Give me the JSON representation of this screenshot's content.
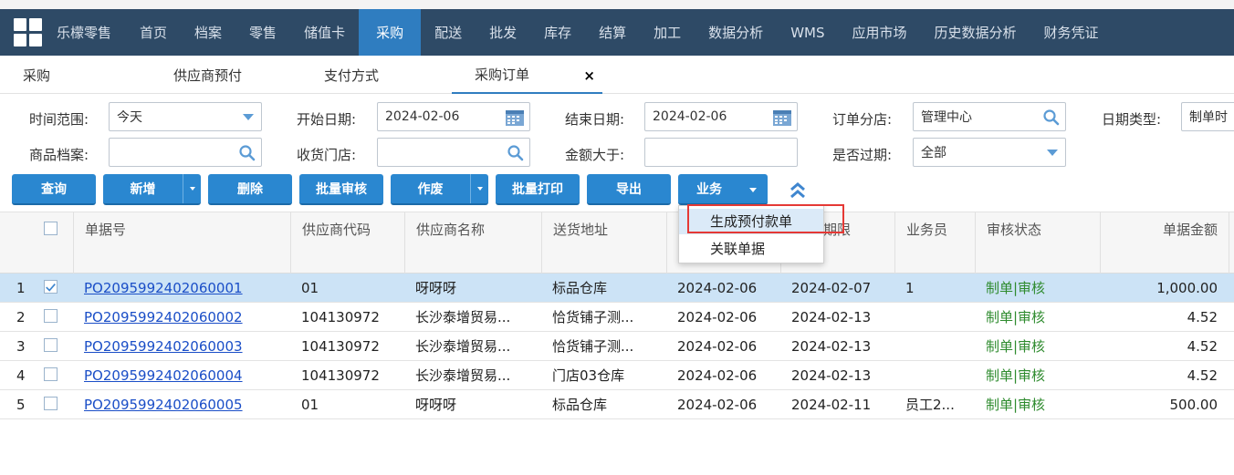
{
  "nav": {
    "brand": "乐檬零售",
    "items": [
      {
        "label": "首页"
      },
      {
        "label": "档案"
      },
      {
        "label": "零售"
      },
      {
        "label": "储值卡"
      },
      {
        "label": "采购",
        "active": true
      },
      {
        "label": "配送"
      },
      {
        "label": "批发"
      },
      {
        "label": "库存"
      },
      {
        "label": "结算"
      },
      {
        "label": "加工"
      },
      {
        "label": "数据分析"
      },
      {
        "label": "WMS"
      },
      {
        "label": "应用市场"
      },
      {
        "label": "历史数据分析"
      },
      {
        "label": "财务凭证"
      }
    ]
  },
  "tabs": [
    {
      "label": "采购"
    },
    {
      "label": "供应商预付"
    },
    {
      "label": "支付方式"
    },
    {
      "label": "采购订单",
      "close": "×"
    }
  ],
  "filters": {
    "time_range_label": "时间范围:",
    "time_range_value": "今天",
    "start_date_label": "开始日期:",
    "start_date_value": "2024-02-06",
    "end_date_label": "结束日期:",
    "end_date_value": "2024-02-06",
    "branch_label": "订单分店:",
    "branch_value": "管理中心",
    "date_type_label": "日期类型:",
    "date_type_value": "制单时",
    "product_label": "商品档案:",
    "product_value": "",
    "receiving_store_label": "收货门店:",
    "receiving_store_value": "",
    "amount_label": "金额大于:",
    "amount_value": "",
    "expired_label": "是否过期:",
    "expired_value": "全部"
  },
  "toolbar": {
    "query": "查询",
    "add": "新增",
    "delete": "删除",
    "batch_audit": "批量审核",
    "void": "作废",
    "batch_print": "批量打印",
    "export": "导出",
    "business": "业务"
  },
  "business_menu": {
    "items": [
      "生成预付款单",
      "关联单据"
    ]
  },
  "table": {
    "headers": [
      "单据号",
      "供应商代码",
      "供应商名称",
      "送货地址",
      "",
      "期限",
      "业务员",
      "审核状态",
      "单据金额"
    ],
    "rows": [
      {
        "n": "1",
        "checked": true,
        "doc": "PO2095992402060001",
        "code": "01",
        "name": "呀呀呀",
        "addr": "标品仓库",
        "d1": "2024-02-06",
        "d2": "2024-02-07",
        "staff": "1",
        "status": "制单|审核",
        "amount": "1,000.00"
      },
      {
        "n": "2",
        "checked": false,
        "doc": "PO2095992402060002",
        "code": "104130972",
        "name": "长沙泰增贸易...",
        "addr": "恰货铺子测...",
        "d1": "2024-02-06",
        "d2": "2024-02-13",
        "staff": "",
        "status": "制单|审核",
        "amount": "4.52"
      },
      {
        "n": "3",
        "checked": false,
        "doc": "PO2095992402060003",
        "code": "104130972",
        "name": "长沙泰增贸易...",
        "addr": "恰货铺子测...",
        "d1": "2024-02-06",
        "d2": "2024-02-13",
        "staff": "",
        "status": "制单|审核",
        "amount": "4.52"
      },
      {
        "n": "4",
        "checked": false,
        "doc": "PO2095992402060004",
        "code": "104130972",
        "name": "长沙泰增贸易...",
        "addr": "门店03仓库",
        "d1": "2024-02-06",
        "d2": "2024-02-13",
        "staff": "",
        "status": "制单|审核",
        "amount": "4.52"
      },
      {
        "n": "5",
        "checked": false,
        "doc": "PO2095992402060005",
        "code": "01",
        "name": "呀呀呀",
        "addr": "标品仓库",
        "d1": "2024-02-06",
        "d2": "2024-02-11",
        "staff": "员工2...",
        "status": "制单|审核",
        "amount": "500.00"
      }
    ]
  },
  "colors": {
    "nav_bg": "#2e4a66",
    "nav_active": "#2f7dc0",
    "button": "#2a87d0",
    "selected_row": "#cce3f6",
    "status_green": "#2e8b2e",
    "highlight_box": "#e53935"
  }
}
